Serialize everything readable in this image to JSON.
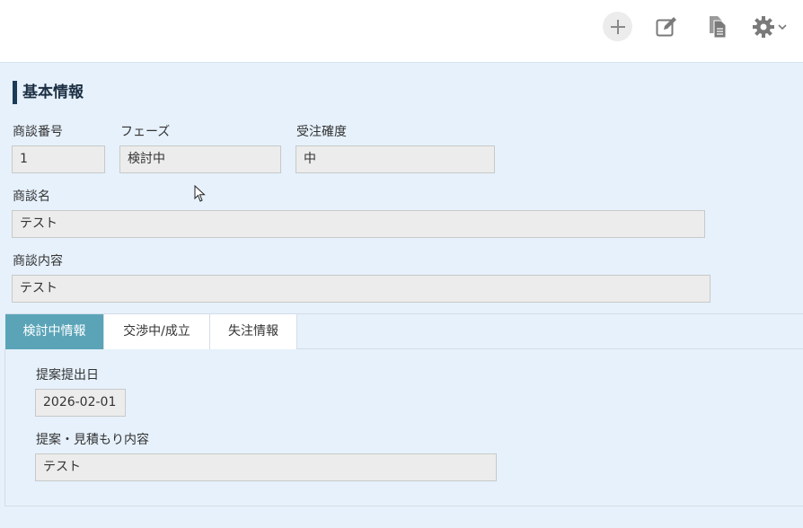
{
  "toolbar": {
    "icons": [
      "plus-icon",
      "edit-icon",
      "document-icon",
      "gear-icon"
    ]
  },
  "section": {
    "title": "基本情報"
  },
  "fields": {
    "deal_number": {
      "label": "商談番号",
      "value": "1"
    },
    "phase": {
      "label": "フェーズ",
      "value": "検討中"
    },
    "order_probability": {
      "label": "受注確度",
      "value": "中"
    },
    "deal_name": {
      "label": "商談名",
      "value": "テスト"
    },
    "deal_details": {
      "label": "商談内容",
      "value": "テスト"
    }
  },
  "tabs": [
    {
      "label": "検討中情報",
      "active": true
    },
    {
      "label": "交渉中/成立",
      "active": false
    },
    {
      "label": "失注情報",
      "active": false
    }
  ],
  "tab_panel": {
    "proposal_date": {
      "label": "提案提出日",
      "value": "2026-02-01"
    },
    "proposal_content": {
      "label": "提案・見積もり内容",
      "value": "テスト"
    }
  },
  "colors": {
    "accent_tab": "#5ba4b8",
    "section_bar": "#1c3b57",
    "background": "#e6f1fb",
    "field_bg": "#ececec"
  }
}
